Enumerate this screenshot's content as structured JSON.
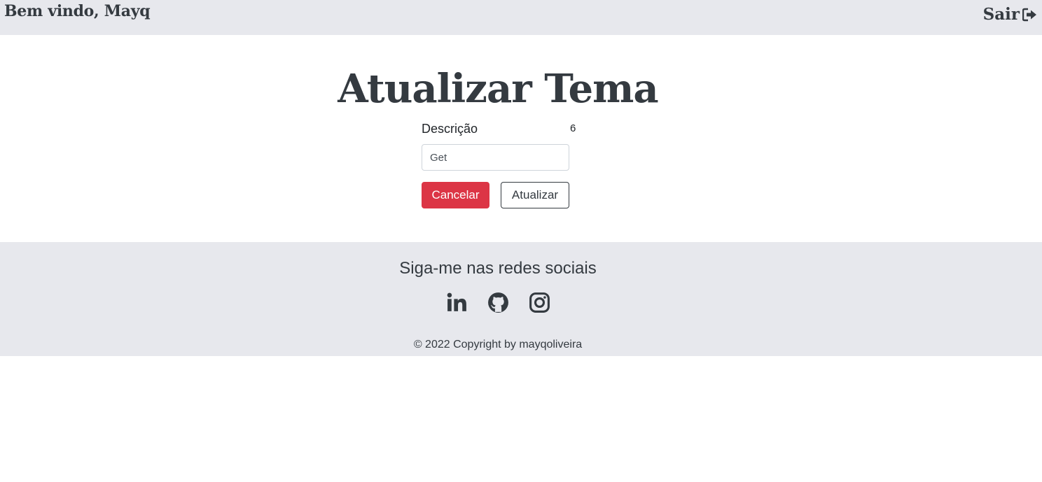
{
  "header": {
    "welcome_text": "Bem vindo, Mayq",
    "logout_label": "Sair",
    "logout_icon": "sign-out-icon"
  },
  "main": {
    "title": "Atualizar Tema",
    "form": {
      "description_label": "Descrição",
      "char_count": "6",
      "description_value": "Get",
      "cancel_label": "Cancelar",
      "update_label": "Atualizar"
    }
  },
  "footer": {
    "social_title": "Siga-me nas redes sociais",
    "social_icons": [
      "linkedin-icon",
      "github-icon",
      "instagram-icon"
    ],
    "copyright": "© 2022 Copyright by mayqoliveira"
  },
  "colors": {
    "header_bg": "#e7e8ed",
    "footer_bg": "#e7e8ed",
    "text_dark": "#343a40",
    "danger": "#dc3545"
  }
}
